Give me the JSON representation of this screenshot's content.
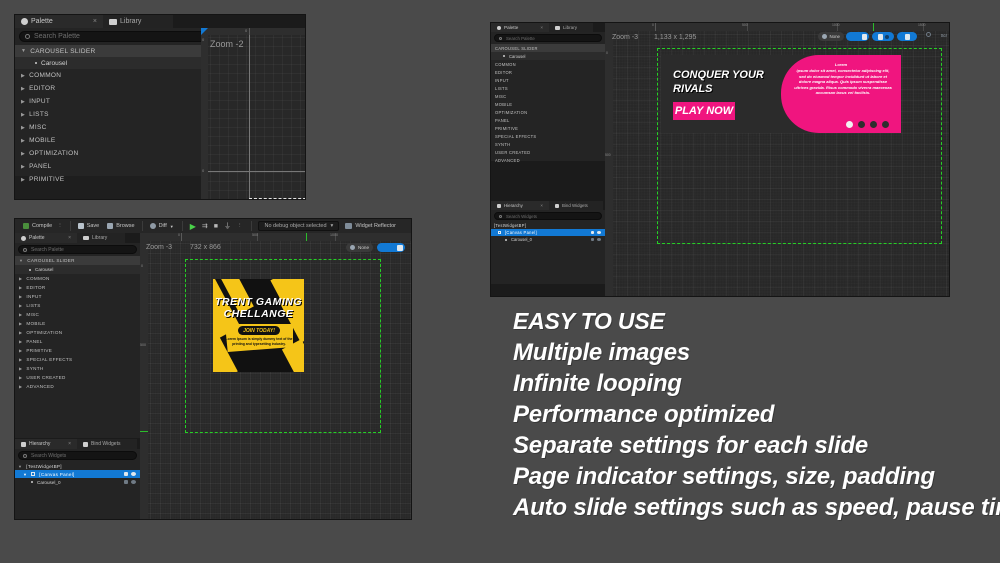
{
  "background_color": "#4a4a4a",
  "accent_colors": {
    "selection_green": "#25d025",
    "ue_blue": "#1279d4",
    "poster_yellow": "#f5c518",
    "banner_pink": "#f0157f",
    "panel_dark": "#1e1e1e"
  },
  "palette_panel": {
    "tabs": [
      {
        "label": "Palette",
        "icon": "palette-icon",
        "active": true,
        "closable": true,
        "close_label": "×"
      },
      {
        "label": "Library",
        "icon": "folder-icon",
        "active": false,
        "closable": false
      }
    ],
    "search": {
      "placeholder": "Search Palette",
      "icon": "search-icon",
      "value": ""
    },
    "categories": [
      {
        "label": "CAROUSEL SLIDER",
        "expanded": true,
        "highlighted": true
      },
      {
        "label": "COMMON",
        "expanded": false
      },
      {
        "label": "EDITOR",
        "expanded": false
      },
      {
        "label": "INPUT",
        "expanded": false
      },
      {
        "label": "LISTS",
        "expanded": false
      },
      {
        "label": "MISC",
        "expanded": false
      },
      {
        "label": "MOBILE",
        "expanded": false
      },
      {
        "label": "OPTIMIZATION",
        "expanded": false
      },
      {
        "label": "PANEL",
        "expanded": false
      },
      {
        "label": "PRIMITIVE",
        "expanded": false
      },
      {
        "label": "SPECIAL EFFECTS",
        "expanded": false
      },
      {
        "label": "SYNTH",
        "expanded": false
      },
      {
        "label": "USER CREATED",
        "expanded": false
      },
      {
        "label": "ADVANCED",
        "expanded": false
      }
    ],
    "carousel_item": "Carousel"
  },
  "hierarchy_panel": {
    "tabs": [
      {
        "label": "Hierarchy",
        "icon": "hierarchy-icon",
        "active": true,
        "close_label": "×"
      },
      {
        "label": "Bind Widgets",
        "icon": "bind-icon",
        "active": false
      }
    ],
    "search": {
      "placeholder": "Search Widgets",
      "icon": "search-icon",
      "value": ""
    },
    "tree": [
      {
        "label": "[TestWidgetBP]",
        "depth": 0,
        "selected": false
      },
      {
        "label": "[Canvas Panel]",
        "depth": 1,
        "selected": true
      },
      {
        "label": "Carousel_0",
        "depth": 2,
        "selected": false
      }
    ]
  },
  "screenshot_1": {
    "zoom_label": "Zoom -2",
    "ruler_ticks": [
      "0"
    ]
  },
  "screenshot_2": {
    "toolbar": [
      {
        "label": "Compile",
        "icon": "compile-icon"
      },
      {
        "label": "Save",
        "icon": "save-icon"
      },
      {
        "label": "Browse",
        "icon": "browse-icon"
      },
      {
        "label": "Diff",
        "icon": "diff-icon",
        "has_caret": true
      }
    ],
    "playback_icons": [
      "play-icon",
      "step-icon",
      "stop-icon",
      "eject-icon",
      "overflow-icon"
    ],
    "debug_dropdown": {
      "label": "No debug object selected",
      "caret": "▾"
    },
    "widget_reflector": {
      "label": "Widget Reflector",
      "icon": "reflector-icon"
    },
    "zoom_label": "Zoom -3",
    "canvas_size": "732 x 866",
    "ruler_ticks": [
      "0",
      "500",
      "1000"
    ],
    "fill_screen": {
      "label": "None",
      "icon": "screen-icon"
    },
    "poster": {
      "title_line1": "TRENT GAMING",
      "title_line2": "CHELLANGE",
      "button_label": "JOIN TODAY!",
      "body_line1": "Lorem Ipsum is simply dummy text of the",
      "body_line2": "printing and typesetting industry."
    }
  },
  "screenshot_3": {
    "zoom_label": "Zoom -3",
    "canvas_size": "1,133 x 1,295",
    "ruler_ticks": [
      "0",
      "500",
      "1000",
      "1500"
    ],
    "fill_screen": {
      "label": "None",
      "icon": "screen-icon"
    },
    "toolbar_right_label": "Scr",
    "toolbar_toggles": [
      "lock-icon",
      "mirror-icon",
      "grid-icon",
      "snap-icon"
    ],
    "banner": {
      "title_line1": "CONQUER YOUR",
      "title_line2": "RIVALS",
      "button_label": "PLAY NOW",
      "lorem_heading": "Lorem",
      "lorem_body": "ipsum dolor sit amet, consectetur adipiscing elit, sed do eiusmod tempor incididunt ut labore et dolore magna aliqua. Quis ipsum suspendisse ultrices gravida. Risus commodo viverra maecenas accumsan lacus vel facilisis.",
      "page_dots": {
        "count": 4,
        "active_index": 0
      }
    }
  },
  "features": {
    "items": [
      "EASY TO USE",
      "Multiple images",
      "Infinite looping",
      "Performance optimized",
      "Separate settings for each slide",
      "Page indicator settings, size, padding",
      "Auto slide settings such as speed, pause time"
    ]
  }
}
